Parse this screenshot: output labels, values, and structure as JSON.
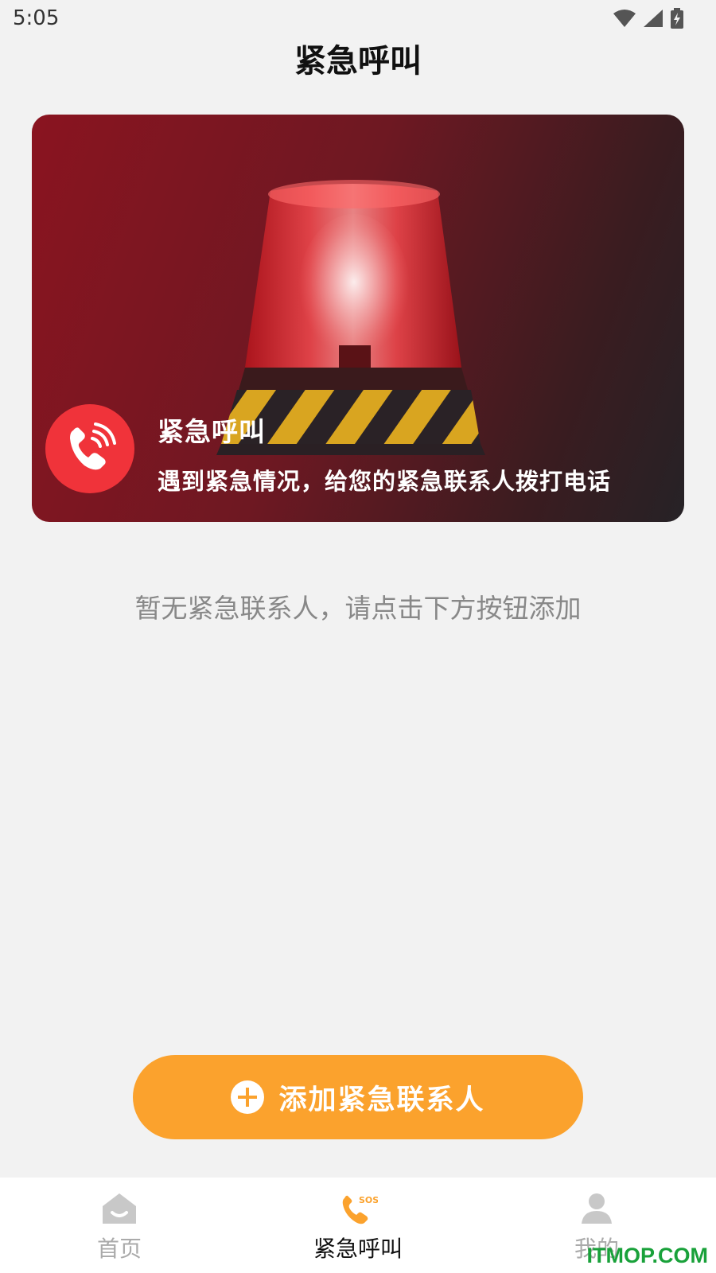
{
  "status_bar": {
    "time": "5:05"
  },
  "header": {
    "title": "紧急呼叫"
  },
  "banner": {
    "title": "紧急呼叫",
    "description": "遇到紧急情况，给您的紧急联系人拨打电话",
    "badge_icon": "phone-ringing-icon"
  },
  "empty_state": {
    "text": "暂无紧急联系人，请点击下方按钮添加"
  },
  "add_button": {
    "label": "添加紧急联系人",
    "icon": "plus-circle-icon"
  },
  "tab_bar": {
    "tabs": [
      {
        "label": "首页",
        "icon": "home-icon",
        "active": false
      },
      {
        "label": "紧急呼叫",
        "icon": "sos-phone-icon",
        "active": true
      },
      {
        "label": "我的",
        "icon": "person-icon",
        "active": false
      }
    ]
  },
  "watermark": "ITMOP.COM",
  "colors": {
    "accent": "#fba22d",
    "banner_red": "#8a1420",
    "badge_red": "#f0333a",
    "active_tab_icon": "#fba22d"
  }
}
